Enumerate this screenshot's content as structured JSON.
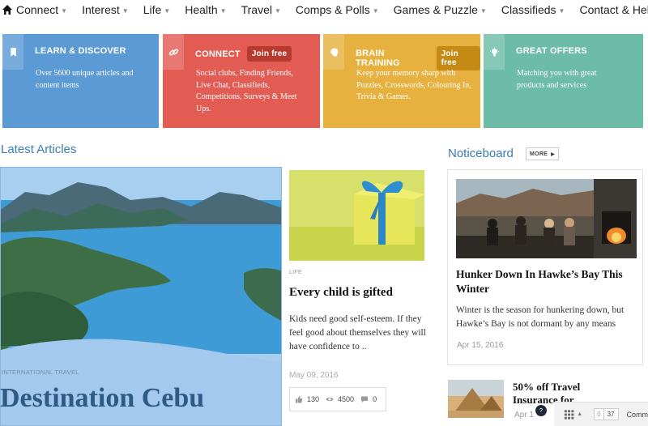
{
  "nav": {
    "items": [
      {
        "label": "Connect"
      },
      {
        "label": "Interest"
      },
      {
        "label": "Life"
      },
      {
        "label": "Health"
      },
      {
        "label": "Travel"
      },
      {
        "label": "Comps & Polls"
      },
      {
        "label": "Games & Puzzle"
      },
      {
        "label": "Classifieds"
      },
      {
        "label": "Contact & Help"
      }
    ]
  },
  "boxes": [
    {
      "title": "LEARN & DISCOVER",
      "desc": "Over 5600 unique articles and content items",
      "color": "#5b9ad5",
      "icon": "bookmark-icon"
    },
    {
      "title": "CONNECT",
      "join": "Join free",
      "desc": "Social clubs, Finding Friends, Live Chat, Classifieds, Competitions, Surveys & Meet Ups.",
      "color": "#e25c53",
      "icon": "link-icon"
    },
    {
      "title": "BRAIN TRAINING",
      "join": "Join free",
      "desc": "Keep your memory sharp with Puzzles, Crosswords, Colouring In, Trivia & Games.",
      "color": "#e6b13f",
      "icon": "brain-icon"
    },
    {
      "title": "GREAT OFFERS",
      "desc": "Matching you with great products and services",
      "color": "#6dbca7",
      "icon": "lightbulb-icon"
    }
  ],
  "latest": {
    "title": "Latest Articles",
    "featured": {
      "category": "INTERNATIONAL TRAVEL",
      "title": "Destination Cebu"
    },
    "article2": {
      "category": "LIFE",
      "title": "Every child is gifted",
      "excerpt": "Kids need good self-esteem. If they feel good about themselves they will have confidence to ..",
      "date": "May 09,  2016",
      "likes": "130",
      "views": "4500",
      "comments": "0"
    }
  },
  "noticeboard": {
    "title": "Noticeboard",
    "more": "MORE",
    "card": {
      "title": "Hunker Down In Hawke’s Bay This Winter",
      "excerpt": "Winter is the season for hunkering down, but Hawke’s Bay is not dormant by any means",
      "date": "Apr 15, 2016"
    },
    "card2": {
      "title": "50% off Travel Insurance for",
      "date": "Apr 1"
    }
  },
  "bottombar": {
    "count_a": "0",
    "count_b": "37",
    "comm": "Comm",
    "help": "?"
  }
}
